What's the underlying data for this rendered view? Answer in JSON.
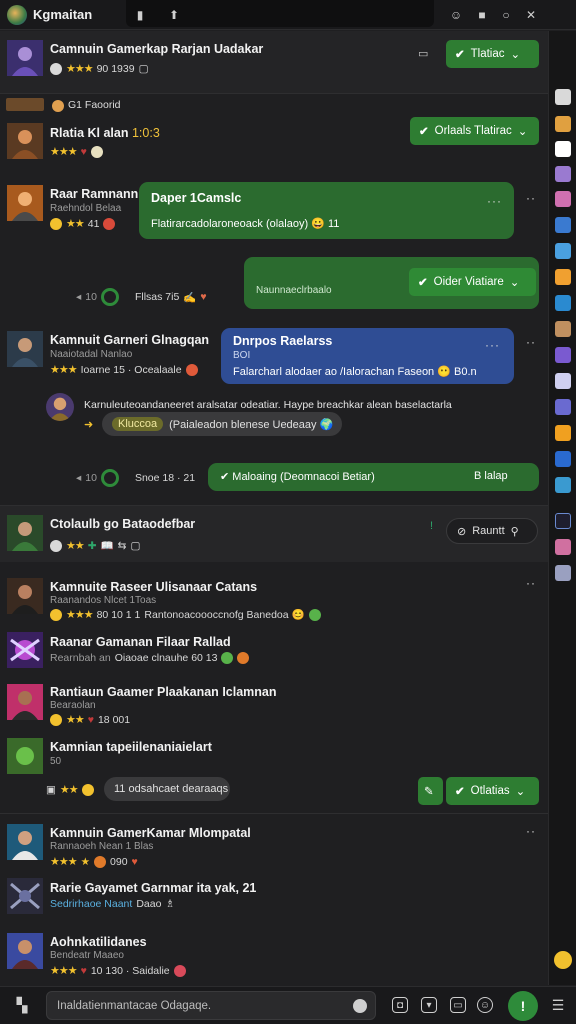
{
  "app": {
    "title": "Kgmaitan"
  },
  "header": {
    "name": "Camnuin Gamerkap Rarjan Uadakar",
    "rating": "★★★",
    "meta": "90 1939",
    "button": "Tlatiac"
  },
  "pinned": {
    "label": "G1 Faoorid"
  },
  "threads": [
    {
      "name": "Rlatia Kl alan",
      "name_suffix": "1:0:3",
      "stars": "★★★",
      "button": "Orlaals Tlatirac"
    },
    {
      "name": "Raar Ramnann",
      "sub": "Raehndol Belaa",
      "meta": "41",
      "bubble_title": "Daper 1Camslc",
      "bubble_text": "Flatirarcadolaroneoack (olalaoy) 😀 11"
    },
    {
      "bubble_meta": "Fllsas 7i5",
      "bubble_sub": "Naunnaeclrbaalo",
      "button": "Oider Viatiare",
      "meta_prefix": "10"
    },
    {
      "name": "Kamnuit Garneri Glnagqan",
      "sub": "Naaiotadal Nanlao",
      "meta": "Ioarne 15 · Ocealaale",
      "bubble_title": "Dnrpos Raelarss",
      "bubble_sub": "BOI",
      "bubble_text": "Falarcharl alodaer ao /Ialorachan Faseon 😶 B0.n"
    },
    {
      "line": "Karnuleuteoandaneeret aralsatar odeatiar. Haype breachkar alean baselactarla",
      "pill": "Kluccoa",
      "pill_text": "(Paialeadon blenese Uedeaay 🌍"
    },
    {
      "meta": "Snoe 18 · 21",
      "button": "Maloaing (Deomnacoi Betiar)",
      "tag": "B lalap",
      "meta_prefix": "10"
    }
  ],
  "section2": {
    "name": "Ctolaulb go Bataodefbar",
    "search_label": "Rauntt"
  },
  "list": [
    {
      "name": "Kamnuite Raseer Ulisanaar Catans",
      "sub": "Raanandos Nlcet 1Toas",
      "meta": "80 10 1 1",
      "extra": "Rantonoacoooccnofg Banedoa 😊"
    },
    {
      "name": "Raanar Gamanan Filaar Rallad",
      "sub": "Rearnbah an",
      "meta": "Oiaoae clnauhe 60 13"
    },
    {
      "name": "Rantiaun Gaamer Plaakanan",
      "sub": "Bearaolan",
      "meta": "18 001",
      "name_suffix": "Iclamnan"
    },
    {
      "name": "Kamnian tapeiilenaniaielart",
      "sub": "50",
      "pill": "11 odsahcaet dearaaqs",
      "button": "Otlatias"
    },
    {
      "name": "Kamnuin GamerKamar Mlompatal",
      "sub": "Rannaoeh Nean 1 Blas",
      "meta": "090"
    },
    {
      "name": "Rarie Gayamet Garnmar ita yak, 21",
      "sub": "Sedrirhaoe Naant",
      "meta": "Daao"
    },
    {
      "name": "Aohnkatilidanes",
      "sub": "Bendeatr Maaeo",
      "meta": "10 130 · Saidalie"
    }
  ],
  "composer": {
    "placeholder": "Inaldatienmantacae Odagaqe."
  },
  "colors": {
    "accent": "#2e7d32",
    "bubble_blue": "#2f4d94",
    "bubble_green": "#2b6b2f",
    "bg": "#1f1f21"
  }
}
